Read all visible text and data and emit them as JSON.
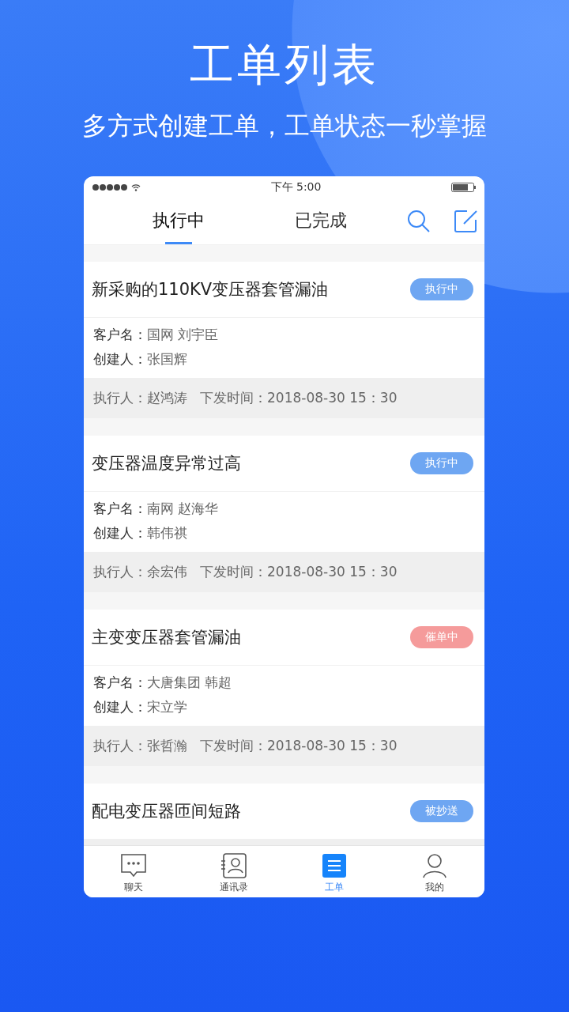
{
  "headline": "工单列表",
  "subtitle": "多方式创建工单，工单状态一秒掌握",
  "status_bar": {
    "time": "下午 5:00"
  },
  "tabs": [
    {
      "label": "执行中",
      "selected": true
    },
    {
      "label": "已完成",
      "selected": false
    }
  ],
  "orders": [
    {
      "title": "新采购的110KV变压器套管漏油",
      "status": "执行中",
      "color": "#6ea6f2",
      "customer_label": "客户名：",
      "customer": "国网 刘宇臣",
      "creator_label": "创建人：",
      "creator": "张国辉",
      "executor_label": "执行人：",
      "executor": "赵鸿涛",
      "time_label": "下发时间：",
      "time": "2018-08-30 15：30"
    },
    {
      "title": "变压器温度异常过高",
      "status": "执行中",
      "color": "#6ea6f2",
      "customer_label": "客户名：",
      "customer": "南网 赵海华",
      "creator_label": "创建人：",
      "creator": "韩伟祺",
      "executor_label": "执行人：",
      "executor": "余宏伟",
      "time_label": "下发时间：",
      "time": "2018-08-30 15：30"
    },
    {
      "title": "主变变压器套管漏油",
      "status": "催单中",
      "color": "#f59b9b",
      "customer_label": "客户名：",
      "customer": "大唐集团 韩超",
      "creator_label": "创建人：",
      "creator": "宋立学",
      "executor_label": "执行人：",
      "executor": "张哲瀚",
      "time_label": "下发时间：",
      "time": "2018-08-30 15：30"
    },
    {
      "title": "配电变压器匝间短路",
      "status": "被抄送",
      "color": "#6ea6f2"
    }
  ],
  "nav": [
    {
      "label": "聊天",
      "kind": "chat",
      "selected": false
    },
    {
      "label": "通讯录",
      "kind": "contacts",
      "selected": false
    },
    {
      "label": "工单",
      "kind": "orders",
      "selected": true
    },
    {
      "label": "我的",
      "kind": "profile",
      "selected": false
    }
  ]
}
